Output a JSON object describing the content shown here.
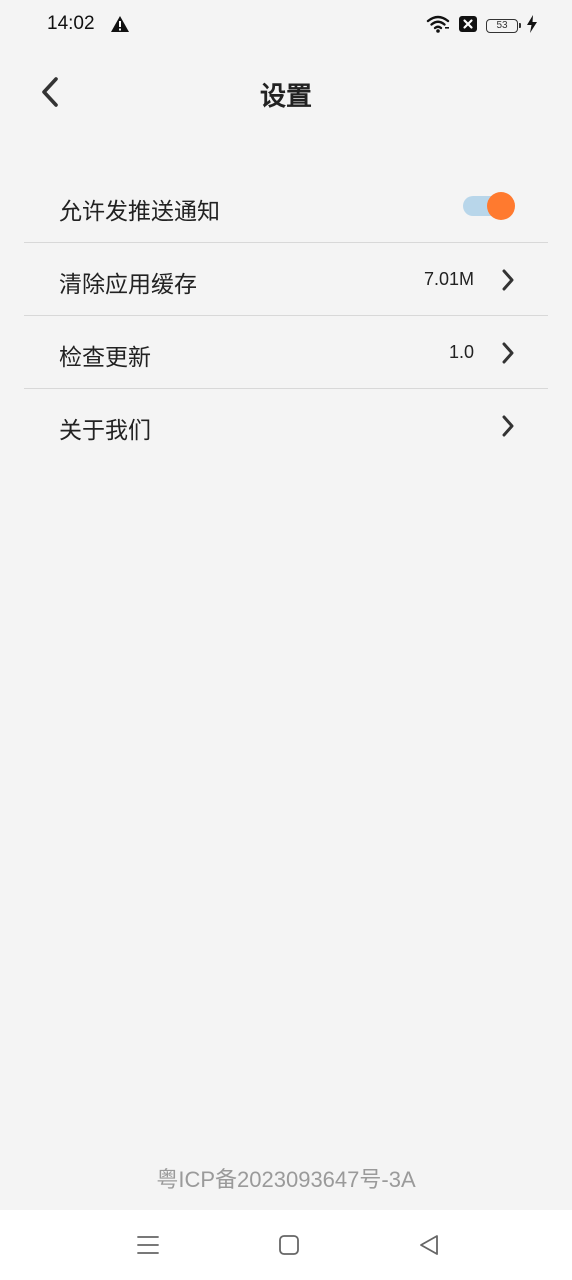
{
  "status_bar": {
    "time": "14:02",
    "battery": "53",
    "icons": [
      "warning-icon",
      "wifi-icon",
      "sim-disabled-icon",
      "battery-icon",
      "charging-bolt-icon"
    ]
  },
  "header": {
    "title": "设置",
    "back_icon": "chevron-left-icon"
  },
  "settings": {
    "push": {
      "label": "允许发推送通知",
      "enabled": true
    },
    "cache": {
      "label": "清除应用缓存",
      "value": "7.01M"
    },
    "update": {
      "label": "检查更新",
      "value": "1.0"
    },
    "about": {
      "label": "关于我们"
    }
  },
  "footer": {
    "icp": "粤ICP备2023093647号-3A"
  },
  "nav": {
    "icons": [
      "menu-icon",
      "home-icon",
      "back-icon"
    ]
  },
  "colors": {
    "accent": "#ff7a2f",
    "toggle_track": "#b8d6ea",
    "background": "#f4f4f4",
    "divider": "#d8d8d8"
  }
}
